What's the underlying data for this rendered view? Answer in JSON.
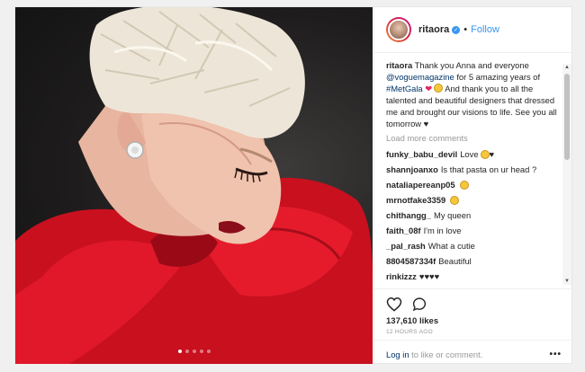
{
  "post": {
    "username": "ritaora",
    "follow_label": "Follow",
    "separator": "•",
    "caption": {
      "part1": "Thank you Anna and everyone ",
      "mention": "@voguemagazine",
      "part2": " for 5 amazing years of ",
      "hashtag": "#MetGala",
      "part3": " And thank you to all the talented and beautiful designers that dressed me and brought our visions to life. See you all tomorrow ♥"
    },
    "load_more": "Load more comments",
    "comments": [
      {
        "user": "funky_babu_devil",
        "text": "Love"
      },
      {
        "user": "shannjoanxo",
        "text": "Is that pasta on ur head ?"
      },
      {
        "user": "nataliapereanp05",
        "text": ""
      },
      {
        "user": "mrnotfake3359",
        "text": ""
      },
      {
        "user": "chithangg_",
        "text": "My queen"
      },
      {
        "user": "faith_08f",
        "text": "I'm in love"
      },
      {
        "user": "_pal_rash",
        "text": "What a cutie"
      },
      {
        "user": "8804587334f",
        "text": "Beautiful"
      },
      {
        "user": "rinkizzz",
        "text": "♥♥♥♥"
      }
    ],
    "likes": "137,610 likes",
    "time": "12 HOURS AGO",
    "login_link": "Log in",
    "login_text": " to like or comment.",
    "more_label": "•••",
    "carousel_index": 1,
    "carousel_count": 5,
    "icons": {
      "like": "heart-outline-icon",
      "comment": "comment-bubble-icon",
      "verified": "verified-badge-icon",
      "more": "more-options-icon"
    }
  }
}
